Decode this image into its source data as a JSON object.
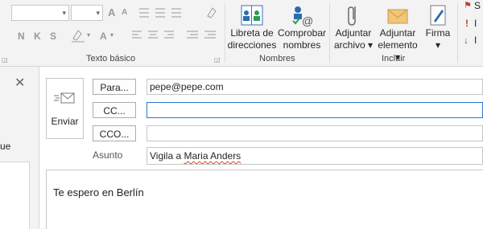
{
  "ribbon": {
    "font_size_placeholder": "",
    "font_name_placeholder": "",
    "format_buttons": {
      "grow": "A",
      "shrink": "A",
      "bold": "N",
      "italic": "K",
      "underline": "S",
      "font_color": "A"
    },
    "groups": {
      "basic_text": "Texto básico",
      "names": "Nombres",
      "include": "Incluir"
    },
    "buttons": {
      "address_book": {
        "line1": "Libreta de",
        "line2": "direcciones"
      },
      "check_names": {
        "line1": "Comprobar",
        "line2": "nombres"
      },
      "attach_file": {
        "line1": "Adjuntar",
        "line2": "archivo ▾"
      },
      "attach_item": {
        "line1": "Adjuntar",
        "line2": "elemento ▾"
      },
      "signature": {
        "line1": "Firma",
        "line2": "▾"
      }
    },
    "right_col": [
      "S",
      "I",
      "I"
    ]
  },
  "leftpane": {
    "partial_text": "ue"
  },
  "compose": {
    "send_label": "Enviar",
    "to_button": "Para...",
    "cc_button": "CC...",
    "bcc_button": "CCO...",
    "to_value": "pepe@pepe.com",
    "cc_value": "",
    "bcc_value": "",
    "subject_label": "Asunto",
    "subject_prefix": "Vigila a ",
    "subject_name": "Maria Anders",
    "body_text": "Te espero en Berlín"
  },
  "colors": {
    "accent": "#2b79d0",
    "ribbon_bg": "#f3f3f3"
  }
}
